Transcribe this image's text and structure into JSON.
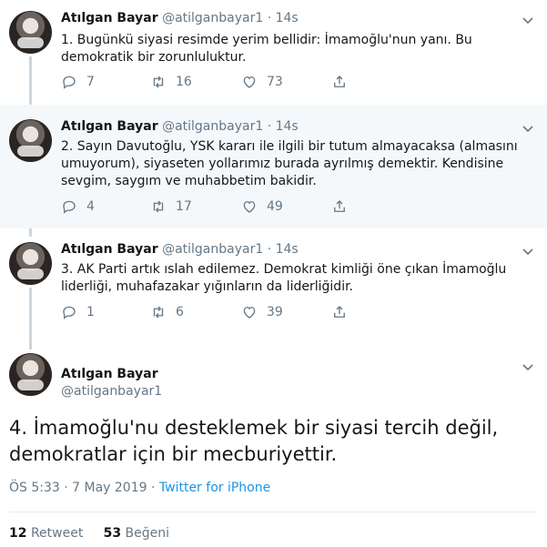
{
  "tweets": [
    {
      "name": "Atılgan Bayar",
      "handle": "@atilganbayar1",
      "dot": "·",
      "time": "14s",
      "text": "1. Bugünkü siyasi resimde yerim bellidir: İmamoğlu'nun yanı. Bu demokratik bir zorunluluktur.",
      "replies": "7",
      "retweets": "16",
      "likes": "73"
    },
    {
      "name": "Atılgan Bayar",
      "handle": "@atilganbayar1",
      "dot": "·",
      "time": "14s",
      "text": "2. Sayın Davutoğlu, YSK kararı ile ilgili bir tutum almayacaksa (almasını umuyorum), siyaseten yollarımız burada ayrılmış demektir. Kendisine sevgim, saygım ve muhabbetim bakidir.",
      "replies": "4",
      "retweets": "17",
      "likes": "49"
    },
    {
      "name": "Atılgan Bayar",
      "handle": "@atilganbayar1",
      "dot": "·",
      "time": "14s",
      "text": "3. AK Parti artık ıslah edilemez. Demokrat kimliği öne çıkan İmamoğlu liderliği, muhafazakar yığınların da liderliğidir.",
      "replies": "1",
      "retweets": "6",
      "likes": "39"
    }
  ],
  "main": {
    "name": "Atılgan Bayar",
    "handle": "@atilganbayar1",
    "text": "4. İmamoğlu'nu desteklemek bir siyasi tercih değil, demokratlar için bir mecburiyettir.",
    "timestamp": "ÖS 5:33 · 7 May 2019 ·",
    "source": "Twitter for iPhone",
    "retweet_count": "12",
    "retweet_label": "Retweet",
    "like_count": "53",
    "like_label": "Beğeni"
  },
  "icons": [
    "chevron-down-icon",
    "reply-icon",
    "retweet-icon",
    "like-icon",
    "share-icon"
  ],
  "colors": {
    "link": "#1b95e0",
    "muted": "#657786",
    "thread_line": "#ccd6dd",
    "shaded_bg": "#f5f8fa"
  }
}
